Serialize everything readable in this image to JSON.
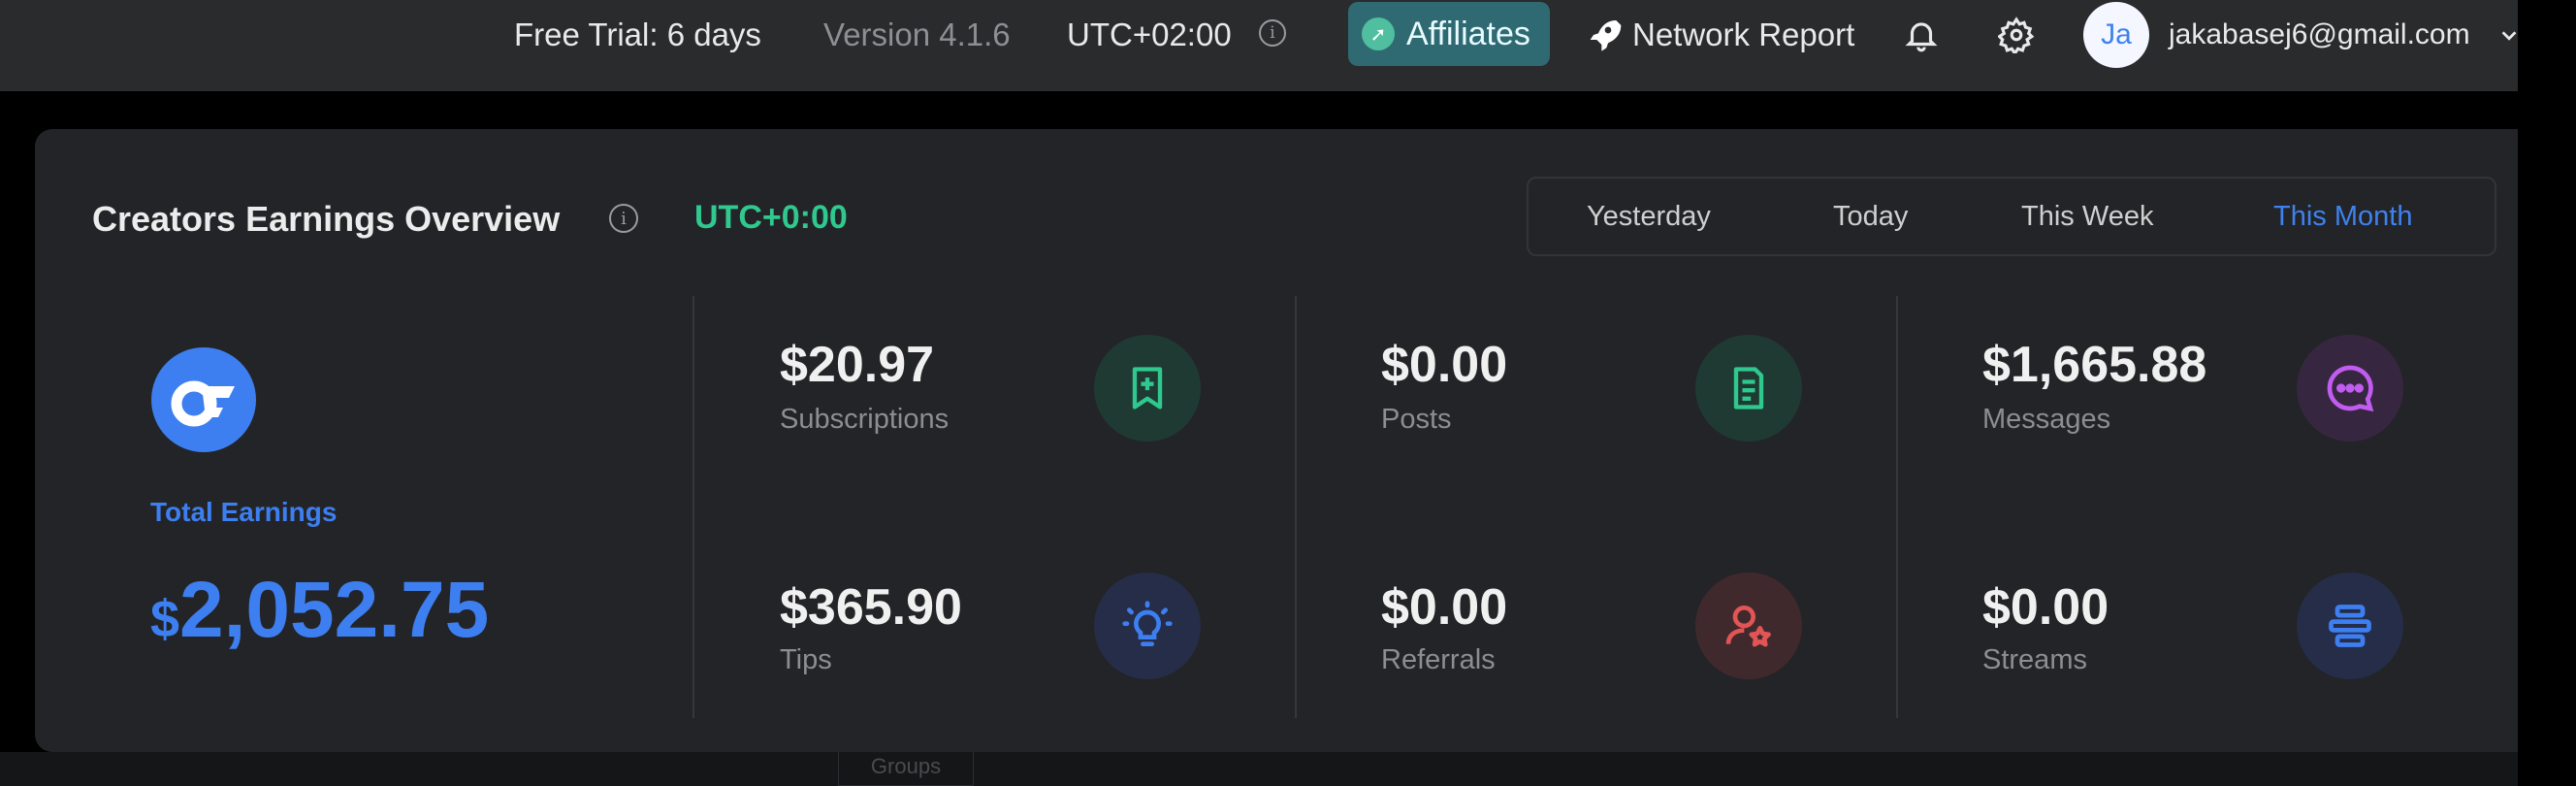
{
  "topbar": {
    "trial": "Free Trial: 6 days",
    "version": "Version 4.1.6",
    "timezone": "UTC+02:00",
    "affiliates": "Affiliates",
    "network_report": "Network Report",
    "avatar_initials": "Ja",
    "email": "jakabasej6@gmail.com"
  },
  "panel": {
    "title": "Creators Earnings Overview",
    "timezone": "UTC+0:00",
    "ranges": [
      "Yesterday",
      "Today",
      "This Week",
      "This Month"
    ],
    "active_range": "This Month",
    "total_label": "Total Earnings",
    "total_currency": "$",
    "total_value": "2,052.75",
    "stats": {
      "subscriptions": {
        "value": "$20.97",
        "label": "Subscriptions",
        "icon": "bookmark-plus-icon",
        "color": "#2fc98f"
      },
      "posts": {
        "value": "$0.00",
        "label": "Posts",
        "icon": "document-icon",
        "color": "#2fc98f"
      },
      "messages": {
        "value": "$1,665.88",
        "label": "Messages",
        "icon": "chat-bubble-icon",
        "color": "#c05cf0"
      },
      "tips": {
        "value": "$365.90",
        "label": "Tips",
        "icon": "lightbulb-icon",
        "color": "#3d7ff0"
      },
      "referrals": {
        "value": "$0.00",
        "label": "Referrals",
        "icon": "user-star-icon",
        "color": "#e25555"
      },
      "streams": {
        "value": "$0.00",
        "label": "Streams",
        "icon": "streams-icon",
        "color": "#3d7ff0"
      }
    }
  },
  "below": {
    "groups_label": "Groups"
  }
}
